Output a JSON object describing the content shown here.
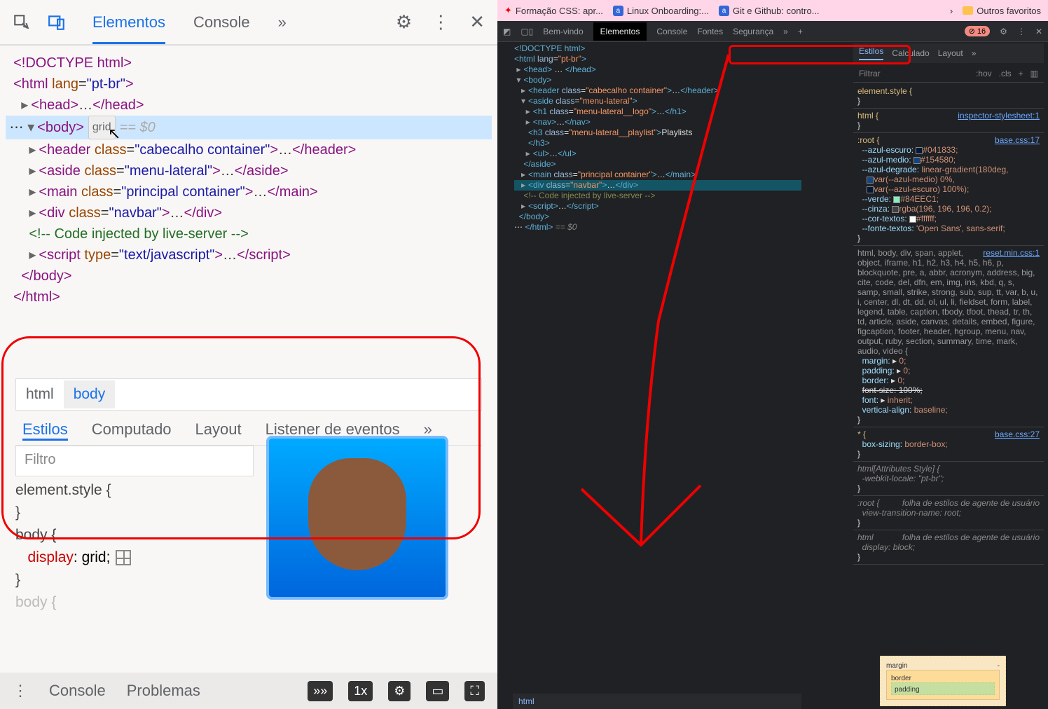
{
  "left": {
    "tabs": {
      "elements": "Elementos",
      "console": "Console"
    },
    "dom": {
      "doctype": "<!DOCTYPE html>",
      "html_open": "<html lang=\"pt-br\">",
      "head": "<head>…</head>",
      "body_open": "<body>",
      "grid_badge": "grid",
      "eq0": "== $0",
      "header": "<header class=\"cabecalho container\">…</header>",
      "aside": "<aside class=\"menu-lateral\">…</aside>",
      "main": "<main class=\"principal container\">…</main>",
      "navbar": "<div class=\"navbar\">…</div>",
      "comment": "<!-- Code injected by live-server -->",
      "script": "<script type=\"text/javascript\">…</scr ipt>",
      "body_close": "</body>",
      "html_close": "</html>"
    },
    "crumbs": {
      "html": "html",
      "body": "body"
    },
    "styles_tabs": {
      "estilos": "Estilos",
      "computado": "Computado",
      "layout": "Layout",
      "listener": "Listener de eventos"
    },
    "filter": "Filtro",
    "rules": {
      "element_style": "element.style {",
      "body_sel": "body {",
      "display": "display",
      "grid": "grid;",
      "body_pale": "body {"
    },
    "bottom": {
      "console": "Console",
      "problemas": "Problemas",
      "x1": "1x"
    }
  },
  "right": {
    "bookmarks": {
      "b1": "Formação CSS: apr...",
      "b2": "Linux Onboarding:...",
      "b3": "Git e Github: contro...",
      "favs": "Outros favoritos"
    },
    "top_tabs": {
      "bemvindo": "Bem-vindo",
      "elementos": "Elementos",
      "console": "Console",
      "fontes": "Fontes",
      "seguranca": "Segurança",
      "errcount": "16"
    },
    "styles_hdr": {
      "estilos": "Estilos",
      "calculado": "Calculado",
      "layout": "Layout"
    },
    "filter": "Filtrar",
    "hov": ":hov",
    "cls": ".cls",
    "dom": {
      "doctype": "<!DOCTYPE html>",
      "html": "<html lang=\"pt-br\">",
      "head": "<head>…</head>",
      "body": "<body>",
      "header": "<header class=\"cabecalho container\">…</header>",
      "aside": "<aside class=\"menu-lateral\">",
      "h1": "<h1 class=\"menu-lateral__logo\">…</h1>",
      "nav": "<nav>…</nav>",
      "h3": "<h3 class=\"menu-lateral__playlist\">Playlists</h3>",
      "ul": "<ul>…</ul>",
      "aside_close": "</aside>",
      "main": "<main class=\"principal container\">…</main>",
      "navbar": "<div class=\"navbar\">…</div>",
      "comment": "<!-- Code injected by live-server -->",
      "script": "<script>…</scr ipt>",
      "body_close": "</body>",
      "html_close_eq": "</html> == $0"
    },
    "styles": {
      "elstyle": "element.style {",
      "html_sel": "html {",
      "link1": "inspector-stylesheet:1",
      "root_sel": ":root {",
      "link2": "base.css:17",
      "vars": {
        "azul_escuro_k": "--azul-escuro:",
        "azul_escuro_v": "#041833;",
        "azul_medio_k": "--azul-medio:",
        "azul_medio_v": "#154580;",
        "azul_degrade_k": "--azul-degrade:",
        "azul_degrade_v": "linear-gradient(180deg,",
        "degrade_l2": "var(--azul-medio) 0%,",
        "degrade_l3": "var(--azul-escuro) 100%);",
        "verde_k": "--verde:",
        "verde_v": "#84EEC1;",
        "cinza_k": "--cinza:",
        "cinza_v": "rgba(196, 196, 196, 0.2);",
        "cor_textos_k": "--cor-textos:",
        "cor_textos_v": "#ffffff;",
        "fonte_k": "--fonte-textos:",
        "fonte_v": "'Open Sans', sans-serif;"
      },
      "reset_sel": "html, body, div, span, applet, object, iframe, h1, h2, h3, h4, h5, h6, p, blockquote, pre, a, abbr, acronym, address, big, cite, code, del, dfn, em, img, ins, kbd, q, s, samp, small, strike, strong, sub, sup, tt, var, b, u, i, center, dl, dt, dd, ol, ul, li, fieldset, form, label, legend, table, caption, tbody, tfoot, thead, tr, th, td, article, aside, canvas, details, embed, figure, figcaption, footer, header, hgroup, menu, nav, output, ruby, section, summary, time, mark, audio, video {",
      "link3": "reset.min.css:1",
      "margin": "margin:",
      "zero": "0;",
      "padding": "padding:",
      "border": "border:",
      "fontsize": "font-size: 100%;",
      "font": "font:",
      "inherit": "inherit;",
      "valign": "vertical-align:",
      "baseline": "baseline;",
      "star_sel": "* {",
      "link4": "base.css:27",
      "boxsizing": "box-sizing:",
      "borderbox": "border-box;",
      "attr_style": "html[Attributes Style] {",
      "webkit_locale": "-webkit-locale:",
      "ptbr": "\"pt-br\";",
      "ua1": "folha de estilos de agente de usuário",
      "root2": ":root {",
      "vtn": "view-transition-name:",
      "rootv": "root;",
      "html2": "html",
      "display": "display:",
      "block": "block;"
    },
    "boxmodel": {
      "margin": "margin",
      "border": "border",
      "padding": "padding"
    },
    "crumb": "html"
  }
}
